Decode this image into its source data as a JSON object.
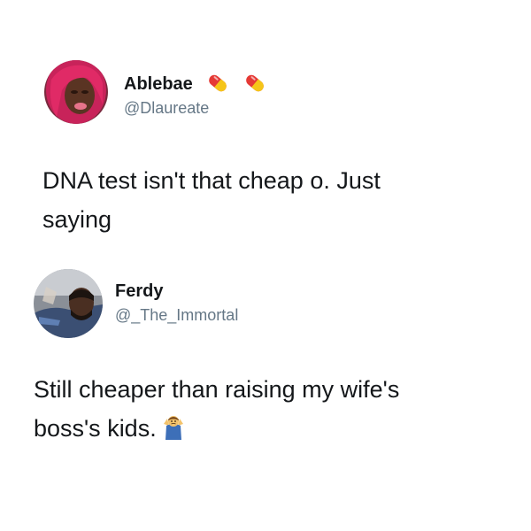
{
  "tweets": [
    {
      "display_name": "Ablebae",
      "handle": "@Dlaureate",
      "name_emojis": [
        "pill-icon",
        "pill-icon"
      ],
      "text_lines": [
        "DNA test isn't that cheap o. Just",
        "saying"
      ],
      "avatar": "avatar-icon"
    },
    {
      "display_name": "Ferdy",
      "handle": "@_The_Immortal",
      "text_lines": [
        "Still cheaper than raising my wife's",
        "boss's kids."
      ],
      "trailing_emoji": "man-shrugging-icon",
      "avatar": "avatar-icon"
    }
  ],
  "colors": {
    "text": "#14171a",
    "handle": "#657786",
    "background": "#ffffff"
  }
}
